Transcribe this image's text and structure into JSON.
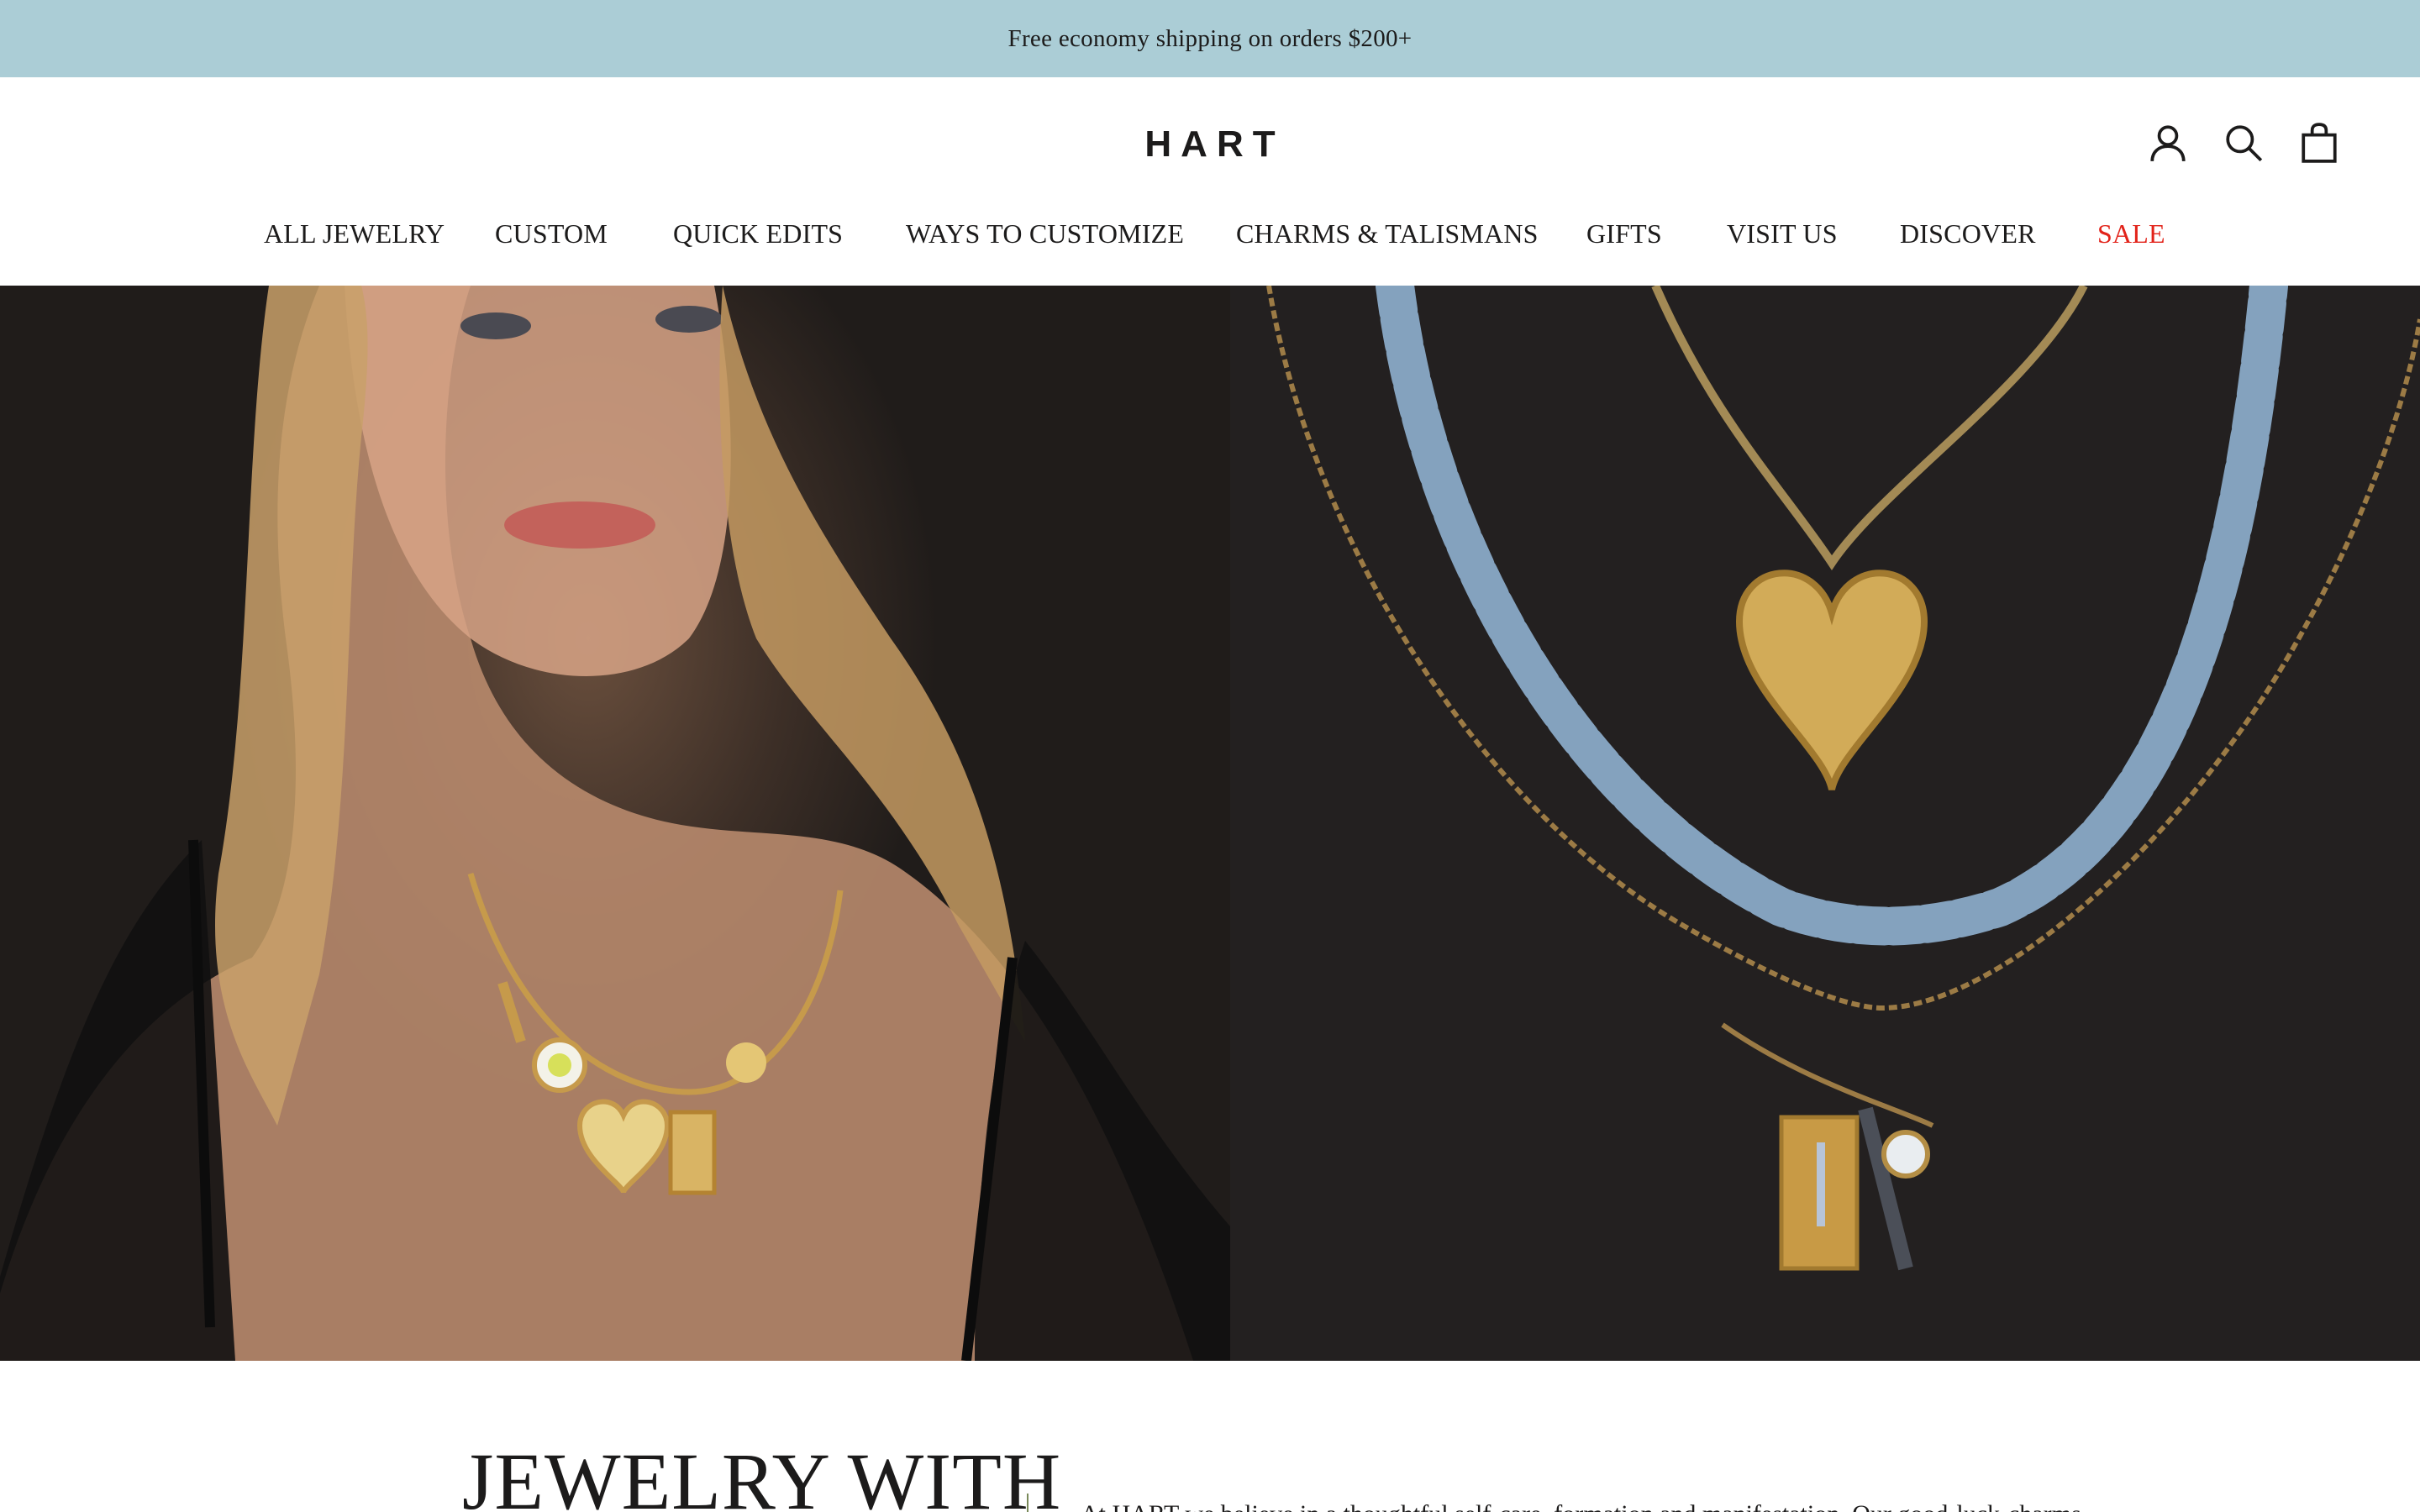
{
  "announcement": {
    "text": "Free economy shipping on orders $200+"
  },
  "header": {
    "logo": "HART",
    "icons": {
      "account": "account-icon",
      "search": "search-icon",
      "cart": "shopping-bag-icon"
    }
  },
  "nav": {
    "items": [
      {
        "label": "ALL JEWELRY"
      },
      {
        "label": "CUSTOM"
      },
      {
        "label": "QUICK EDITS"
      },
      {
        "label": "WAYS TO CUSTOMIZE"
      },
      {
        "label": "CHARMS & TALISMANS"
      },
      {
        "label": "GIFTS"
      },
      {
        "label": "VISIT US"
      },
      {
        "label": "DISCOVER"
      },
      {
        "label": "SALE"
      }
    ],
    "sale_color": "#e2231a"
  },
  "hero": {
    "slides_total": 2,
    "active_slide": 2
  },
  "intro": {
    "heading": "JEWELRY WITH",
    "text": "At HART we believe in a thoughtful self-care, formation and manifestation. Our good-luck-charms"
  },
  "colors": {
    "announcement_bg": "#abcdd6",
    "text": "#1c1b1b",
    "sale": "#e2231a"
  }
}
